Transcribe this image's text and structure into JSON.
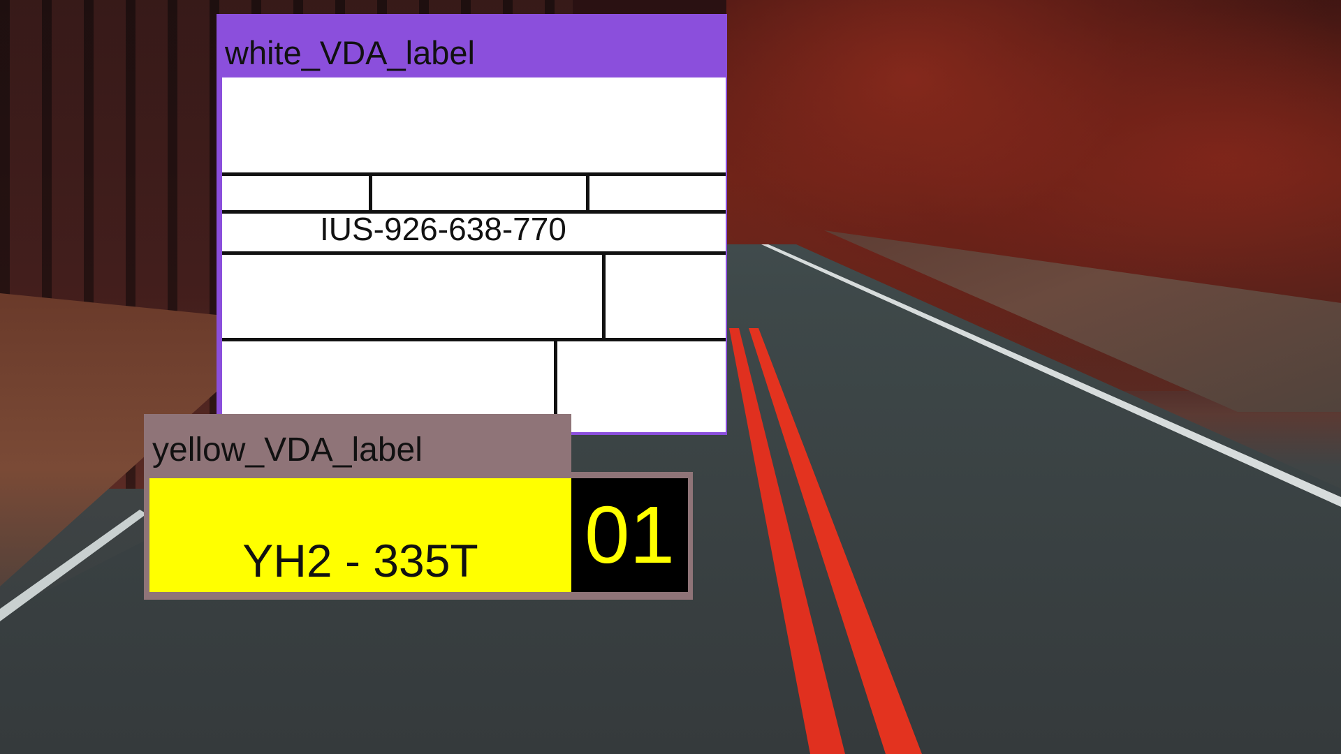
{
  "white_label": {
    "title": "white_VDA_label",
    "code": "IUS-926-638-770",
    "frame_color": "#8b4fdc"
  },
  "yellow_label": {
    "title": "yellow_VDA_label",
    "code": "YH2 - 335T",
    "number": "01",
    "frame_color": "#8f7478",
    "main_color": "#ffff00"
  }
}
